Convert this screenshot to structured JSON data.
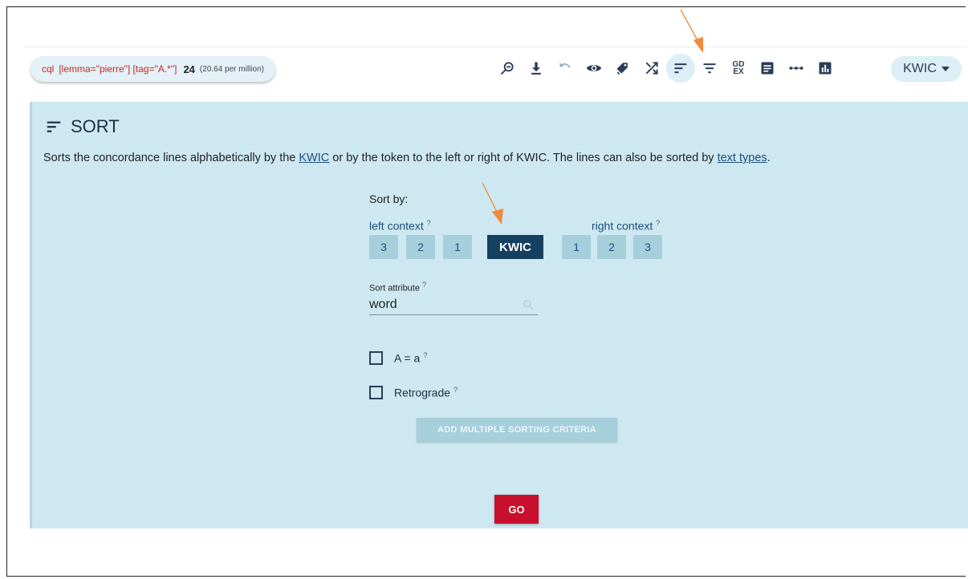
{
  "query": {
    "type": "cql",
    "text": "[lemma=\"pierre\"] [tag=\"A.*\"]",
    "count": "24",
    "per_million": "(20.64 per million)"
  },
  "toolbar": {
    "tools": [
      "zoom-out-icon",
      "download-icon",
      "undo-icon",
      "eye-icon",
      "tag-icon",
      "shuffle-icon",
      "sort-icon",
      "filter-icon",
      "gdex-icon",
      "details-icon",
      "dots-icon",
      "frequency-icon"
    ],
    "gdex_line1": "GD",
    "gdex_line2": "EX",
    "view_mode": "KWIC"
  },
  "sort": {
    "title": "SORT",
    "description_part1": "Sorts the concordance lines alphabetically by the ",
    "description_link1": "KWIC",
    "description_part2": " or by the token to the left or right of KWIC. The lines can also be sorted by ",
    "description_link2": "text types",
    "description_part3": ".",
    "sort_by_label": "Sort by:",
    "left_context_label": "left context",
    "right_context_label": "right context",
    "help_mark": "?",
    "left_buttons": [
      "3",
      "2",
      "1"
    ],
    "kwic_label": "KWIC",
    "right_buttons": [
      "1",
      "2",
      "3"
    ],
    "attribute_label": "Sort attribute",
    "attribute_value": "word",
    "case_label": "A = a",
    "retrograde_label": "Retrograde",
    "multi_button": "ADD MULTIPLE SORTING CRITERIA",
    "go_button": "GO"
  },
  "colors": {
    "panel_bg": "#cde8f1",
    "kwic_active": "#16405f",
    "go": "#c8102e",
    "annotation_arrow": "#f08a3c"
  }
}
